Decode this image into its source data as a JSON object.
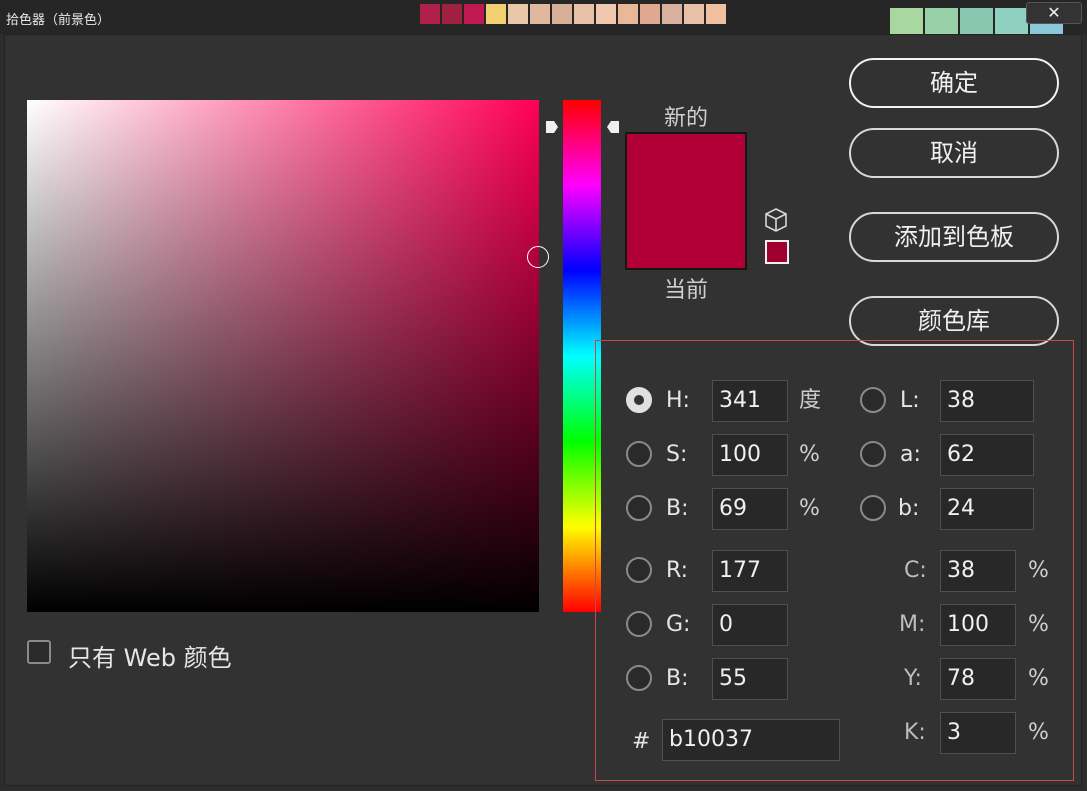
{
  "window": {
    "title": "拾色器（前景色）",
    "close_glyph": "✕"
  },
  "background_swatches": [
    "#b0204a",
    "#a02040",
    "#c01850",
    "#f0d070",
    "#e8c8a8",
    "#e0b8a0",
    "#d8b098",
    "#e8c0a8",
    "#f0c8b0",
    "#e8b898",
    "#e0a890",
    "#d8b0a0",
    "#e8c0a8",
    "#f0c0a0"
  ],
  "background_swatches_right": [
    "#a8d8a0",
    "#98d0a8",
    "#88c8b0",
    "#90d0c0",
    "#88c8d8"
  ],
  "picker": {
    "hue_color": "#ff0056",
    "label_new": "新的",
    "label_current": "当前",
    "new_color": "#b10037",
    "current_color": "#b10037",
    "web_safe_color": "#a00030"
  },
  "buttons": {
    "ok": "确定",
    "cancel": "取消",
    "add_to_swatches": "添加到色板",
    "color_libraries": "颜色库"
  },
  "fields": {
    "h": {
      "label": "H:",
      "value": "341",
      "unit": "度"
    },
    "s": {
      "label": "S:",
      "value": "100",
      "unit": "%"
    },
    "b": {
      "label": "B:",
      "value": "69",
      "unit": "%"
    },
    "r": {
      "label": "R:",
      "value": "177"
    },
    "g": {
      "label": "G:",
      "value": "0"
    },
    "b2": {
      "label": "B:",
      "value": "55"
    },
    "l": {
      "label": "L:",
      "value": "38"
    },
    "a": {
      "label": "a:",
      "value": "62"
    },
    "lab_b": {
      "label": "b:",
      "value": "24"
    },
    "c": {
      "label": "C:",
      "value": "38",
      "unit": "%"
    },
    "m": {
      "label": "M:",
      "value": "100",
      "unit": "%"
    },
    "y": {
      "label": "Y:",
      "value": "78",
      "unit": "%"
    },
    "k": {
      "label": "K:",
      "value": "3",
      "unit": "%"
    },
    "hex": {
      "label": "#",
      "value": "b10037"
    }
  },
  "web_colors_only": {
    "label": "只有 Web 颜色",
    "checked": false
  }
}
